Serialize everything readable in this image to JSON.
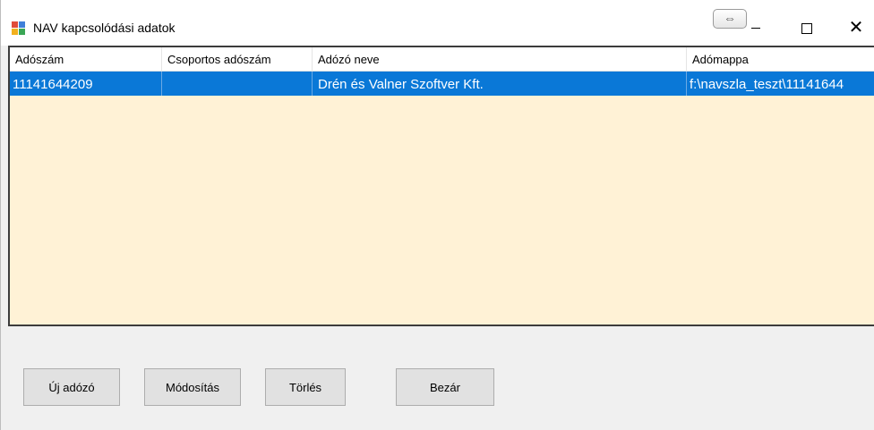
{
  "window": {
    "title": "NAV kapcsolódási adatok",
    "resize_glyph": "⇔",
    "close_glyph": "✕"
  },
  "list": {
    "columns": [
      "Adószám",
      "Csoportos adószám",
      "Adózó neve",
      "Adómappa"
    ],
    "rows": [
      {
        "adoszam": "11141644209",
        "csoportos_adoszam": "",
        "adozo_neve": "Drén és Valner Szoftver Kft.",
        "adomappa": "f:\\navszla_teszt\\11141644"
      }
    ],
    "selected_row": 0,
    "background_color": "#fff2d6",
    "selection_color": "#0a78d7"
  },
  "buttons": {
    "new": "Új adózó",
    "edit": "Módosítás",
    "delete": "Törlés",
    "close": "Bezár"
  }
}
